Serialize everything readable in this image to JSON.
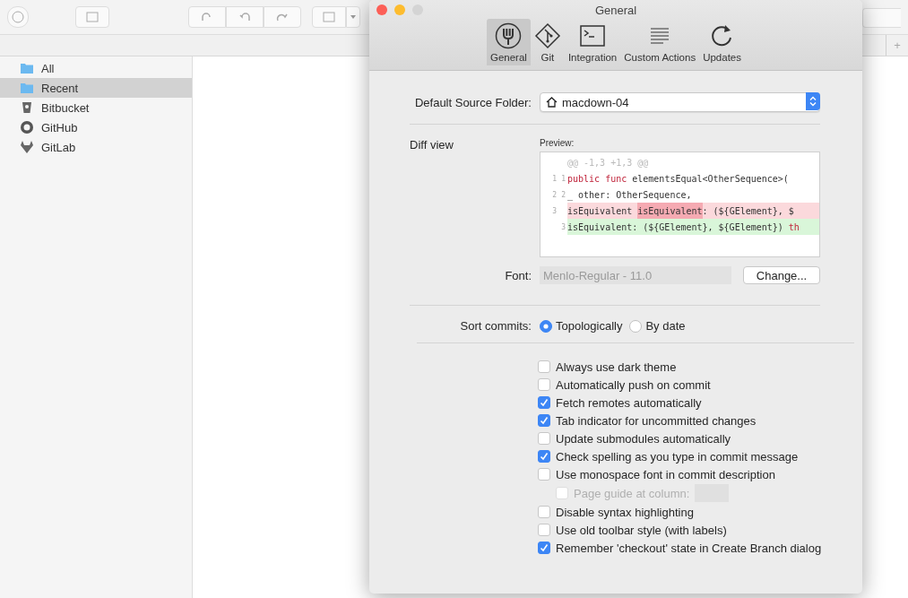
{
  "sidebar": {
    "items": [
      {
        "label": "All",
        "selected": false
      },
      {
        "label": "Recent",
        "selected": true
      },
      {
        "label": "Bitbucket",
        "selected": false
      },
      {
        "label": "GitHub",
        "selected": false
      },
      {
        "label": "GitLab",
        "selected": false
      }
    ]
  },
  "new_tab_button": "+",
  "preferences": {
    "title": "General",
    "tabs": [
      {
        "label": "General",
        "selected": true
      },
      {
        "label": "Git",
        "selected": false
      },
      {
        "label": "Integration",
        "selected": false
      },
      {
        "label": "Custom Actions",
        "selected": false
      },
      {
        "label": "Updates",
        "selected": false
      }
    ],
    "default_source_folder": {
      "label": "Default Source Folder:",
      "value": "macdown-04"
    },
    "diff_view": {
      "label": "Diff view",
      "preview_label": "Preview:",
      "lines": [
        {
          "kind": "hunk",
          "segments": [
            {
              "text": "@@ -1,3 +1,3 @@",
              "kind": "plain"
            }
          ]
        },
        {
          "kind": "context",
          "old": "1",
          "new": "1",
          "segments": [
            {
              "text": "public func",
              "kind": "keyword"
            },
            {
              "text": " elementsEqual<OtherSequence>(",
              "kind": "plain"
            }
          ]
        },
        {
          "kind": "context",
          "old": "2",
          "new": "2",
          "segments": [
            {
              "text": "_ other: OtherSequence,",
              "kind": "plain"
            }
          ]
        },
        {
          "kind": "removed",
          "old": "3",
          "segments": [
            {
              "text": "isEquivalent ",
              "kind": "plain"
            },
            {
              "text": "isEquivalent",
              "kind": "changed"
            },
            {
              "text": ": (${GElement}, $",
              "kind": "plain"
            }
          ]
        },
        {
          "kind": "added",
          "new": "3",
          "segments": [
            {
              "text": "isEquivalent: (${GElement}, ${GElement}) ",
              "kind": "plain"
            },
            {
              "text": "th",
              "kind": "keyword"
            }
          ]
        }
      ],
      "font_label": "Font:",
      "font_value": "Menlo-Regular - 11.0",
      "change_button": "Change..."
    },
    "sort_commits": {
      "label": "Sort commits:",
      "options": [
        {
          "label": "Topologically",
          "selected": true
        },
        {
          "label": "By date",
          "selected": false
        }
      ]
    },
    "options": [
      {
        "label": "Always use dark theme",
        "checked": false,
        "kind": "plain"
      },
      {
        "label": "Automatically push on commit",
        "checked": false,
        "kind": "plain"
      },
      {
        "label": "Fetch remotes automatically",
        "checked": true,
        "kind": "plain"
      },
      {
        "label": "Tab indicator for uncommitted changes",
        "checked": true,
        "kind": "plain"
      },
      {
        "label": "Update submodules automatically",
        "checked": false,
        "kind": "plain"
      },
      {
        "label": "Check spelling as you type in commit message",
        "checked": true,
        "kind": "plain"
      },
      {
        "label": "Use monospace font in commit description",
        "checked": false,
        "kind": "plain",
        "children": [
          {
            "label": "Page guide at column:",
            "checked": false,
            "disabled": true,
            "kind": "with_field"
          }
        ]
      },
      {
        "label": "Disable syntax highlighting",
        "checked": false,
        "kind": "plain"
      },
      {
        "label": "Use old toolbar style (with labels)",
        "checked": false,
        "kind": "plain"
      },
      {
        "label": "Remember 'checkout' state in Create Branch dialog",
        "checked": true,
        "kind": "plain"
      }
    ]
  }
}
